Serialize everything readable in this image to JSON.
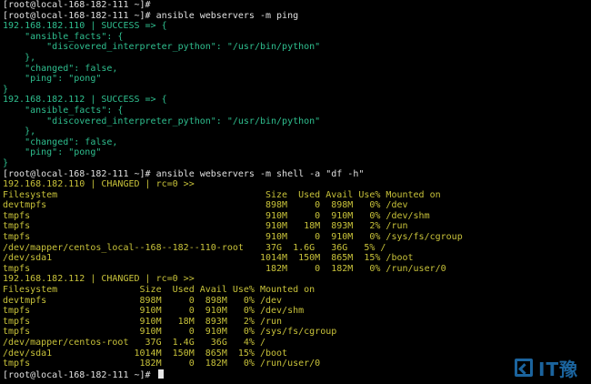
{
  "terminal": {
    "lines": [
      {
        "text": "[root@local-168-182-111 ~]#",
        "color": "w"
      },
      {
        "text": "[root@local-168-182-111 ~]# ansible webservers -m ping",
        "color": "w"
      },
      {
        "text": "192.168.182.110 | SUCCESS => {",
        "color": "g"
      },
      {
        "text": "    \"ansible_facts\": {",
        "color": "g"
      },
      {
        "text": "        \"discovered_interpreter_python\": \"/usr/bin/python\"",
        "color": "g"
      },
      {
        "text": "    },",
        "color": "g"
      },
      {
        "text": "    \"changed\": false,",
        "color": "g"
      },
      {
        "text": "    \"ping\": \"pong\"",
        "color": "g"
      },
      {
        "text": "}",
        "color": "g"
      },
      {
        "text": "192.168.182.112 | SUCCESS => {",
        "color": "g"
      },
      {
        "text": "    \"ansible_facts\": {",
        "color": "g"
      },
      {
        "text": "        \"discovered_interpreter_python\": \"/usr/bin/python\"",
        "color": "g"
      },
      {
        "text": "    },",
        "color": "g"
      },
      {
        "text": "    \"changed\": false,",
        "color": "g"
      },
      {
        "text": "    \"ping\": \"pong\"",
        "color": "g"
      },
      {
        "text": "}",
        "color": "g"
      },
      {
        "text": "[root@local-168-182-111 ~]# ansible webservers -m shell -a \"df -h\"",
        "color": "w"
      },
      {
        "text": "192.168.182.110 | CHANGED | rc=0 >>",
        "color": "y"
      },
      {
        "text": "Filesystem                                      Size  Used Avail Use% Mounted on",
        "color": "y"
      },
      {
        "text": "devtmpfs                                        898M     0  898M   0% /dev",
        "color": "y"
      },
      {
        "text": "tmpfs                                           910M     0  910M   0% /dev/shm",
        "color": "y"
      },
      {
        "text": "tmpfs                                           910M   18M  893M   2% /run",
        "color": "y"
      },
      {
        "text": "tmpfs                                           910M     0  910M   0% /sys/fs/cgroup",
        "color": "y"
      },
      {
        "text": "/dev/mapper/centos_local--168--182--110-root    37G  1.6G   36G   5% /",
        "color": "y"
      },
      {
        "text": "/dev/sda1                                      1014M  150M  865M  15% /boot",
        "color": "y"
      },
      {
        "text": "tmpfs                                           182M     0  182M   0% /run/user/0",
        "color": "y"
      },
      {
        "text": "192.168.182.112 | CHANGED | rc=0 >>",
        "color": "y"
      },
      {
        "text": "Filesystem               Size  Used Avail Use% Mounted on",
        "color": "y"
      },
      {
        "text": "devtmpfs                 898M     0  898M   0% /dev",
        "color": "y"
      },
      {
        "text": "tmpfs                    910M     0  910M   0% /dev/shm",
        "color": "y"
      },
      {
        "text": "tmpfs                    910M   18M  893M   2% /run",
        "color": "y"
      },
      {
        "text": "tmpfs                    910M     0  910M   0% /sys/fs/cgroup",
        "color": "y"
      },
      {
        "text": "/dev/mapper/centos-root   37G  1.4G   36G   4% /",
        "color": "y"
      },
      {
        "text": "/dev/sda1               1014M  150M  865M  15% /boot",
        "color": "y"
      },
      {
        "text": "tmpfs                    182M     0  182M   0% /run/user/0",
        "color": "y"
      },
      {
        "text": "[root@local-168-182-111 ~]# ",
        "color": "w",
        "cursor": true
      }
    ]
  },
  "watermark": {
    "text": "IT豫",
    "color": "#1f6fb0"
  }
}
